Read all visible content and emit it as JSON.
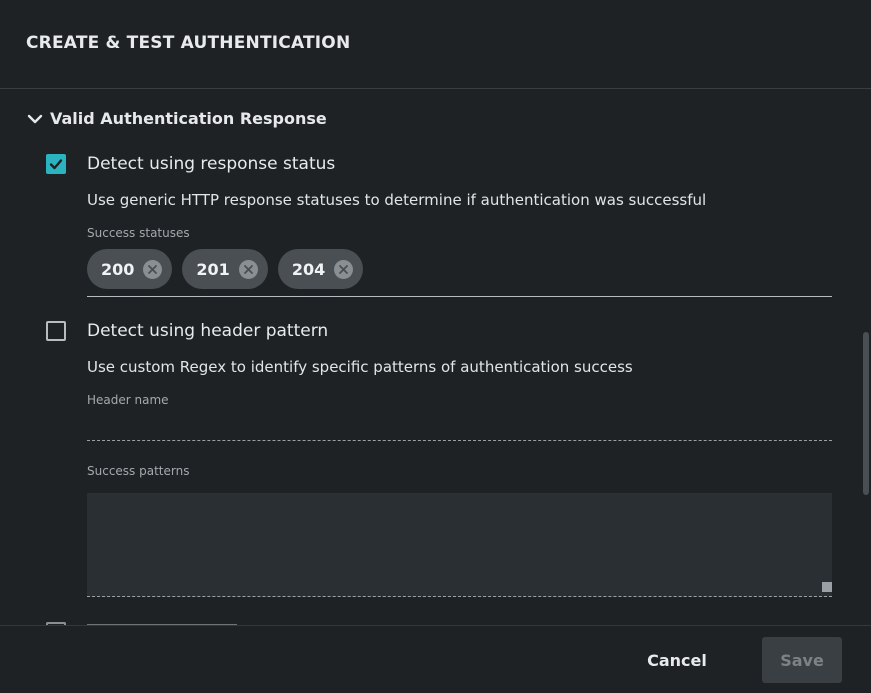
{
  "dialog": {
    "title": "CREATE & TEST AUTHENTICATION"
  },
  "section": {
    "title": "Valid Authentication Response",
    "icon": "chevron-down-icon",
    "expanded": true
  },
  "response_status": {
    "checked": true,
    "label": "Detect using response status",
    "description": "Use generic HTTP response statuses to determine if authentication was successful",
    "field_label": "Success statuses",
    "chips": [
      {
        "label": "200"
      },
      {
        "label": "201"
      },
      {
        "label": "204"
      }
    ]
  },
  "header_pattern": {
    "checked": false,
    "label": "Detect using header pattern",
    "description": "Use custom Regex to identify specific patterns of authentication success",
    "header_name_label": "Header name",
    "header_name_value": "",
    "success_patterns_label": "Success patterns",
    "success_patterns_value": ""
  },
  "footer": {
    "cancel_label": "Cancel",
    "save_label": "Save"
  },
  "colors": {
    "accent": "#2bb3c0",
    "background": "#1e2225",
    "chip": "#4a4f53",
    "disabled_button": "#3a3f44"
  }
}
